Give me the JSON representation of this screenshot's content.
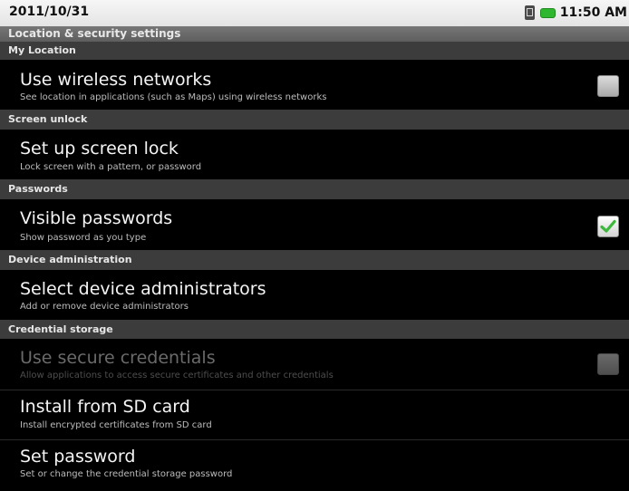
{
  "status_bar": {
    "date": "2011/10/31",
    "time": "11:50 AM",
    "icons": [
      "sim-card-icon",
      "battery-icon"
    ],
    "battery_color": "#2fb82f"
  },
  "title": "Location & security settings",
  "sections": {
    "my_location": "My Location",
    "screen_unlock": "Screen unlock",
    "passwords": "Passwords",
    "device_admin": "Device administration",
    "credential_storage": "Credential storage"
  },
  "prefs": {
    "wireless": {
      "title": "Use wireless networks",
      "summary": "See location in applications (such as Maps) using wireless networks",
      "checked": false,
      "enabled": true
    },
    "screen_lock": {
      "title": "Set up screen lock",
      "summary": "Lock screen with a pattern, or password"
    },
    "visible_passwords": {
      "title": "Visible passwords",
      "summary": "Show password as you type",
      "checked": true,
      "enabled": true
    },
    "device_admins": {
      "title": "Select device administrators",
      "summary": "Add or remove device administrators"
    },
    "secure_credentials": {
      "title": "Use secure credentials",
      "summary": "Allow applications to access secure certificates and other credentials",
      "checked": false,
      "enabled": false
    },
    "install_sd": {
      "title": "Install from SD card",
      "summary": "Install encrypted certificates from SD card"
    },
    "set_password": {
      "title": "Set password",
      "summary": "Set or change the credential storage password"
    }
  },
  "colors": {
    "check_green": "#3cb83c",
    "background": "#000000",
    "section_header": "#3c3c3c"
  }
}
